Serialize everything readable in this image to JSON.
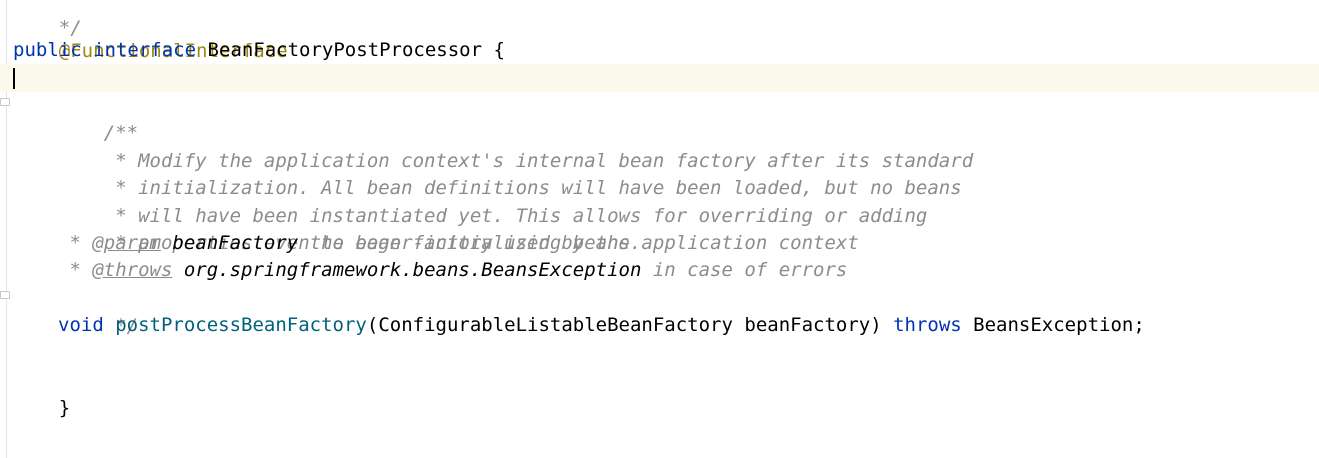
{
  "code": {
    "prev_line": "*/",
    "annotation": "@FunctionalInterface",
    "decl": {
      "kw_public": "public",
      "kw_interface": "interface",
      "name": "BeanFactoryPostProcessor",
      "brace": "{"
    },
    "javadoc": {
      "open": "/**",
      "line1": " * Modify the application context's internal bean factory after its standard",
      "line2": " * initialization. All bean definitions will have been loaded, but no beans",
      "line3": " * will have been instantiated yet. This allows for overriding or adding",
      "line4": " * properties even to eager-initializing beans.",
      "param_prefix": " * ",
      "param_tag": "@param",
      "param_name": "beanFactory",
      "param_desc": " the bean factory used by the application context",
      "throws_prefix": " * ",
      "throws_tag": "@throws",
      "throws_type": "org.springframework.beans.BeansException",
      "throws_desc": " in case of errors",
      "close": " */"
    },
    "method": {
      "kw_void": "void",
      "name": "postProcessBeanFactory",
      "params": "(ConfigurableListableBeanFactory beanFactory) ",
      "kw_throws": "throws",
      "exception": " BeansException;"
    },
    "closing_brace": "}"
  }
}
